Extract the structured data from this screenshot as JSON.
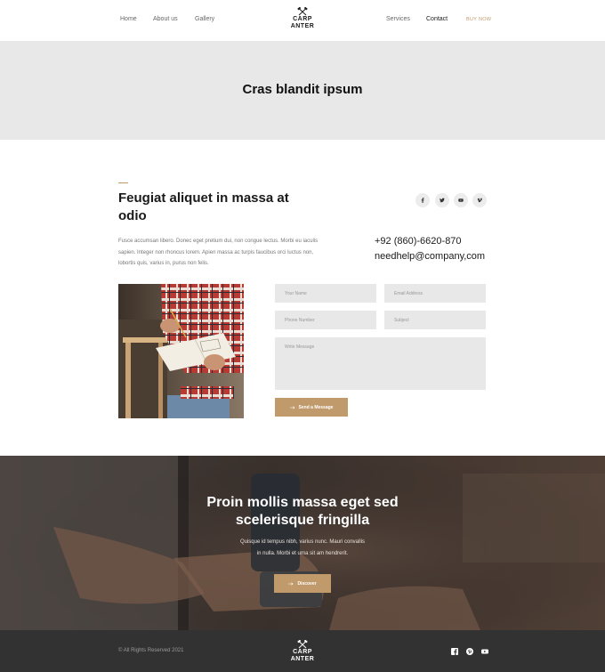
{
  "colors": {
    "accent": "#c19a6b",
    "band": "#e8e8e8",
    "footer": "#323232",
    "text": "#1a1a1a"
  },
  "header": {
    "nav_left": [
      {
        "label": "Home"
      },
      {
        "label": "About us"
      },
      {
        "label": "Gallery"
      }
    ],
    "logo": {
      "line1": "CARP",
      "line2": "ANTER",
      "icon": "crossed-hammers-icon"
    },
    "nav_right": [
      {
        "label": "Services"
      },
      {
        "label": "Contact"
      }
    ],
    "cta_label": "BUY NOW"
  },
  "page_title": "Cras blandit ipsum",
  "contact": {
    "heading": "Feugiat aliquet in massa at odio",
    "text": "Fusce accumsan libero. Donec eget pretium dui, non congue lectus. Morbi eu iaculis sapien. Integer non rhoncus lorem. Apien massa ac turpis faucibus orci luctus non, lobortis quis, varius in, purus non felis.",
    "phone": "+92 (860)-6620-870",
    "email": "needhelp@company,com",
    "social": [
      "facebook-icon",
      "twitter-icon",
      "youtube-icon",
      "vimeo-icon"
    ]
  },
  "form": {
    "name_placeholder": "Your Name",
    "email_placeholder": "Email Address",
    "phone_placeholder": "Phone Number",
    "subject_placeholder": "Subject",
    "message_placeholder": "Write Message",
    "submit_label": "Send a Message"
  },
  "hero": {
    "title_line1": "Proin mollis massa eget sed",
    "title_line2": "scelerisque fringilla",
    "text_line1": "Quisque id tempus nibh, varius nunc. Mauri convallis",
    "text_line2": "in nulla. Morbi et urna sit am hendrerit.",
    "button_label": "Discover"
  },
  "footer": {
    "copyright": "© All Rights Reserved 2021",
    "logo": {
      "line1": "CARP",
      "line2": "ANTER"
    },
    "social": [
      "facebook-icon",
      "pinterest-icon",
      "youtube-icon"
    ]
  }
}
